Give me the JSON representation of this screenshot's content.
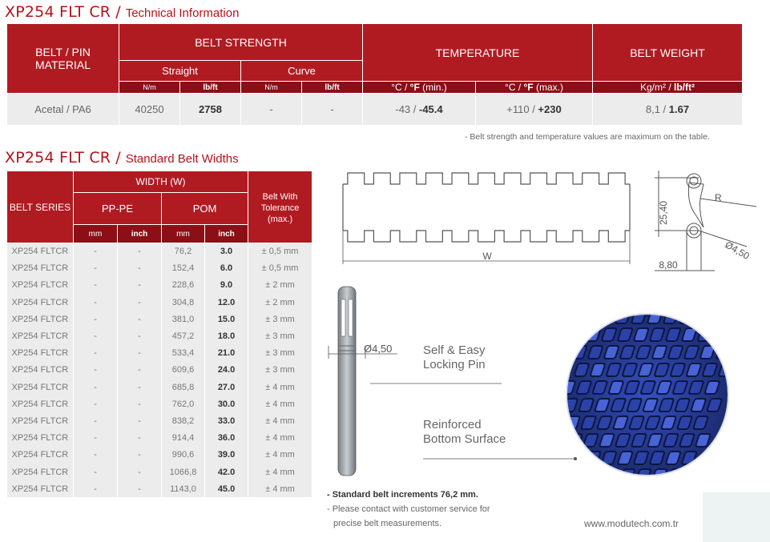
{
  "tech_title": {
    "code": "XP254 FLT CR",
    "sep": " / ",
    "sub": "Technical Information"
  },
  "tech_table": {
    "h_material": "BELT / PIN MATERIAL",
    "h_strength": "BELT STRENGTH",
    "h_temperature": "TEMPERATURE",
    "h_weight": "BELT WEIGHT",
    "h_straight": "Straight",
    "h_curve": "Curve",
    "unit_nm": "N/m",
    "unit_lbft": "lb/ft",
    "unit_temp_min_a": "°C / ",
    "unit_temp_min_b": "°F",
    "unit_temp_min_c": " (min.)",
    "unit_temp_max_a": "°C / ",
    "unit_temp_max_b": "°F",
    "unit_temp_max_c": " (max.)",
    "unit_weight_a": "Kg/m² / ",
    "unit_weight_b": "lb/ft²",
    "row": {
      "material": "Acetal / PA6",
      "straight_nm": "40250",
      "straight_lbft": "2758",
      "curve_nm": "-",
      "curve_lbft": "-",
      "temp_min_c": "-43 / ",
      "temp_min_f": "-45.4",
      "temp_max_c": "+110 / ",
      "temp_max_f": "+230",
      "weight_kg": "8,1 / ",
      "weight_lb": "1.67"
    }
  },
  "tech_note": "- Belt strength and temperature values are maximum on the table.",
  "widths_title": {
    "code": "XP254 FLT CR",
    "sep": " / ",
    "sub": "Standard Belt Widths"
  },
  "widths_table": {
    "h_series": "BELT SERIES",
    "h_width": "WIDTH (W)",
    "h_tolerance": "Belt With Tolerance (max.)",
    "h_pppe": "PP-PE",
    "h_pom": "POM",
    "unit_mm": "mm",
    "unit_inch": "inch",
    "rows": [
      {
        "series": "XP254 FLTCR",
        "pp_mm": "-",
        "pp_inch": "-",
        "pom_mm": "76,2",
        "pom_inch": "3.0",
        "tol": "± 0,5 mm"
      },
      {
        "series": "XP254 FLTCR",
        "pp_mm": "-",
        "pp_inch": "-",
        "pom_mm": "152,4",
        "pom_inch": "6.0",
        "tol": "± 0,5 mm"
      },
      {
        "series": "XP254 FLTCR",
        "pp_mm": "-",
        "pp_inch": "-",
        "pom_mm": "228,6",
        "pom_inch": "9.0",
        "tol": "± 2 mm"
      },
      {
        "series": "XP254 FLTCR",
        "pp_mm": "-",
        "pp_inch": "-",
        "pom_mm": "304,8",
        "pom_inch": "12.0",
        "tol": "± 2 mm"
      },
      {
        "series": "XP254 FLTCR",
        "pp_mm": "-",
        "pp_inch": "-",
        "pom_mm": "381,0",
        "pom_inch": "15.0",
        "tol": "± 3 mm"
      },
      {
        "series": "XP254 FLTCR",
        "pp_mm": "-",
        "pp_inch": "-",
        "pom_mm": "457,2",
        "pom_inch": "18.0",
        "tol": "± 3 mm"
      },
      {
        "series": "XP254 FLTCR",
        "pp_mm": "-",
        "pp_inch": "-",
        "pom_mm": "533,4",
        "pom_inch": "21.0",
        "tol": "± 3 mm"
      },
      {
        "series": "XP254 FLTCR",
        "pp_mm": "-",
        "pp_inch": "-",
        "pom_mm": "609,6",
        "pom_inch": "24.0",
        "tol": "± 3 mm"
      },
      {
        "series": "XP254 FLTCR",
        "pp_mm": "-",
        "pp_inch": "-",
        "pom_mm": "685,8",
        "pom_inch": "27.0",
        "tol": "± 4 mm"
      },
      {
        "series": "XP254 FLTCR",
        "pp_mm": "-",
        "pp_inch": "-",
        "pom_mm": "762,0",
        "pom_inch": "30.0",
        "tol": "± 4 mm"
      },
      {
        "series": "XP254 FLTCR",
        "pp_mm": "-",
        "pp_inch": "-",
        "pom_mm": "838,2",
        "pom_inch": "33.0",
        "tol": "± 4 mm"
      },
      {
        "series": "XP254 FLTCR",
        "pp_mm": "-",
        "pp_inch": "-",
        "pom_mm": "914,4",
        "pom_inch": "36.0",
        "tol": "± 4 mm"
      },
      {
        "series": "XP254 FLTCR",
        "pp_mm": "-",
        "pp_inch": "-",
        "pom_mm": "990,6",
        "pom_inch": "39.0",
        "tol": "± 4 mm"
      },
      {
        "series": "XP254 FLTCR",
        "pp_mm": "-",
        "pp_inch": "-",
        "pom_mm": "1066,8",
        "pom_inch": "42.0",
        "tol": "± 4 mm"
      },
      {
        "series": "XP254 FLTCR",
        "pp_mm": "-",
        "pp_inch": "-",
        "pom_mm": "1143,0",
        "pom_inch": "45.0",
        "tol": "± 4 mm"
      }
    ]
  },
  "diagram": {
    "w_label": "W",
    "height_label": "25,40",
    "r_label": "R",
    "hole_label": "Ø4,50",
    "pitch_label": "8,80",
    "pin_diameter": "Ø4,50"
  },
  "labels": {
    "pin_line1": "Self & Easy",
    "pin_line2": "Locking Pin",
    "surface_line1": "Reinforced",
    "surface_line2": "Bottom Surface"
  },
  "bottom_notes": {
    "increments": "- Standard belt increments 76,2 mm.",
    "contact1": "- Please contact with customer service for",
    "contact2": "precise belt measurements."
  },
  "website": "www.modutech.com.tr",
  "colors": {
    "brand_red": "#b01b22",
    "dark_red": "#8b0f16",
    "row_gray": "#ececec",
    "belt_blue": "#2a3f9e"
  }
}
